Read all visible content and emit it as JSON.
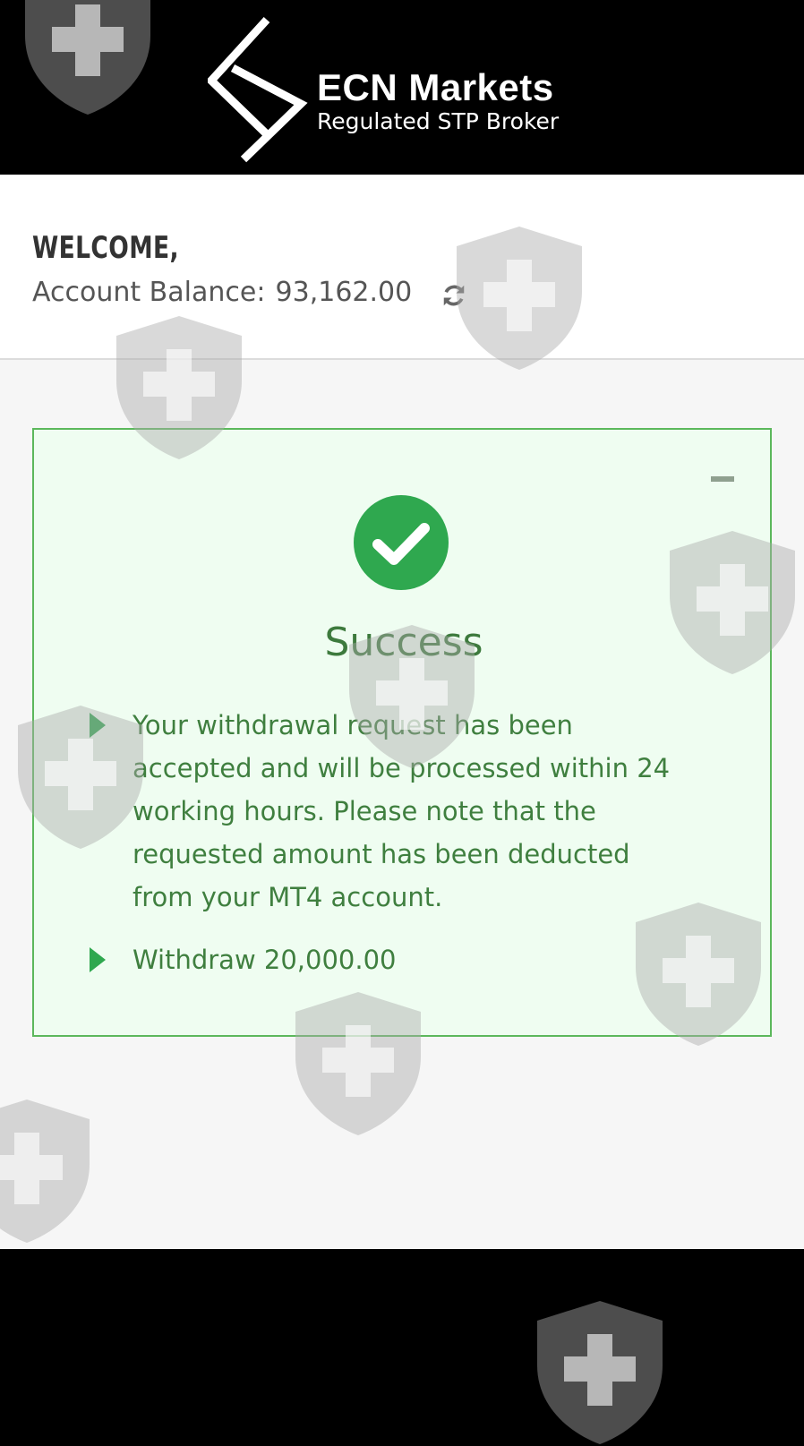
{
  "header": {
    "brand_title": "ECN Markets",
    "brand_subtitle": "Regulated STP Broker"
  },
  "account": {
    "welcome": "WELCOME,",
    "balance_label": "Account Balance:",
    "balance_value": "93,162.00",
    "refresh_icon": "refresh-icon"
  },
  "alert": {
    "icon": "check-circle-icon",
    "title": "Success",
    "messages": [
      "Your withdrawal request has been\naccepted and will be processed within 24\nworking hours. Please note that the\nrequested amount has been deducted\nfrom your MT4 account.",
      "Withdraw 20,000.00"
    ]
  },
  "colors": {
    "success_green": "#2fa84f",
    "alert_border": "#5cb85c",
    "alert_bg": "#effdf1",
    "text_green": "#3f7f3f"
  }
}
